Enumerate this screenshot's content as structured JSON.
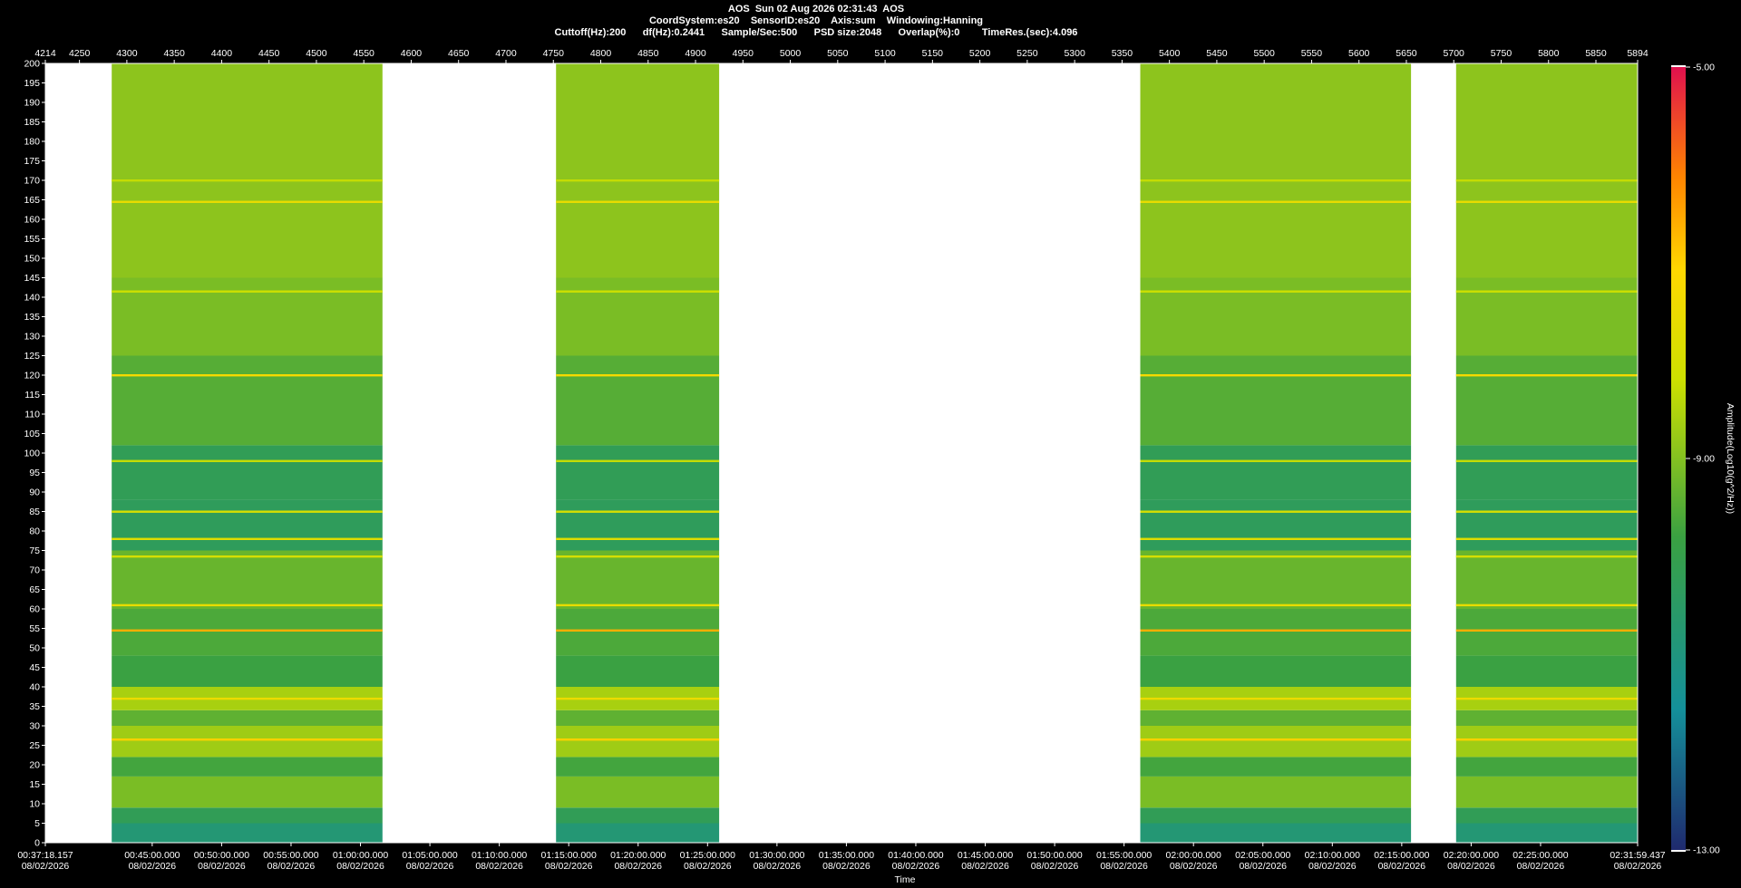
{
  "header": {
    "title": "AOS  Sun 02 Aug 2026 02:31:43  AOS",
    "line2": "CoordSystem:es20    SensorID:es20    Axis:sum    Windowing:Hanning",
    "line3": "Cuttoff(Hz):200      df(Hz):0.2441      Sample/Sec:500      PSD size:2048      Overlap(%):0        TimeRes.(sec):4.096"
  },
  "chart_data": {
    "type": "heatmap",
    "title": "AOS  Sun 02 Aug 2026 02:31:43  AOS",
    "xlabel": "Time",
    "ylabel": "",
    "colorbar_label": "Amplitude(Log10(g^2/Hz))",
    "colorbar_ticks": [
      "-5.00",
      "-9.00",
      "-13.00"
    ],
    "colorbar_range": [
      -13,
      -5
    ],
    "ylim": [
      0,
      200
    ],
    "y_ticks": [
      0,
      5,
      10,
      15,
      20,
      25,
      30,
      35,
      40,
      45,
      50,
      55,
      60,
      65,
      70,
      75,
      80,
      85,
      90,
      95,
      100,
      105,
      110,
      115,
      120,
      125,
      130,
      135,
      140,
      145,
      150,
      155,
      160,
      165,
      170,
      175,
      180,
      185,
      190,
      195,
      200
    ],
    "top_axis_range": [
      4214,
      5894
    ],
    "top_ticks": [
      4214,
      4250,
      4300,
      4350,
      4400,
      4450,
      4500,
      4550,
      4600,
      4650,
      4700,
      4750,
      4800,
      4850,
      4900,
      4950,
      5000,
      5050,
      5100,
      5150,
      5200,
      5250,
      5300,
      5350,
      5400,
      5450,
      5500,
      5550,
      5600,
      5650,
      5700,
      5750,
      5800,
      5850,
      5894
    ],
    "x_start": "00:37:18.157",
    "x_end": "02:31:59.437",
    "time_ticks": [
      {
        "time": "00:37:18.157",
        "date": "08/02/2026"
      },
      {
        "time": "00:45:00.000",
        "date": "08/02/2026"
      },
      {
        "time": "00:50:00.000",
        "date": "08/02/2026"
      },
      {
        "time": "00:55:00.000",
        "date": "08/02/2026"
      },
      {
        "time": "01:00:00.000",
        "date": "08/02/2026"
      },
      {
        "time": "01:05:00.000",
        "date": "08/02/2026"
      },
      {
        "time": "01:10:00.000",
        "date": "08/02/2026"
      },
      {
        "time": "01:15:00.000",
        "date": "08/02/2026"
      },
      {
        "time": "01:20:00.000",
        "date": "08/02/2026"
      },
      {
        "time": "01:25:00.000",
        "date": "08/02/2026"
      },
      {
        "time": "01:30:00.000",
        "date": "08/02/2026"
      },
      {
        "time": "01:35:00.000",
        "date": "08/02/2026"
      },
      {
        "time": "01:40:00.000",
        "date": "08/02/2026"
      },
      {
        "time": "01:45:00.000",
        "date": "08/02/2026"
      },
      {
        "time": "01:50:00.000",
        "date": "08/02/2026"
      },
      {
        "time": "01:55:00.000",
        "date": "08/02/2026"
      },
      {
        "time": "02:00:00.000",
        "date": "08/02/2026"
      },
      {
        "time": "02:05:00.000",
        "date": "08/02/2026"
      },
      {
        "time": "02:10:00.000",
        "date": "08/02/2026"
      },
      {
        "time": "02:15:00.000",
        "date": "08/02/2026"
      },
      {
        "time": "02:20:00.000",
        "date": "08/02/2026"
      },
      {
        "time": "02:25:00.000",
        "date": "08/02/2026"
      },
      {
        "time": "02:31:59.437",
        "date": "08/02/2026"
      }
    ],
    "data_segments": [
      {
        "start": "00:42:05.000",
        "end": "01:01:35.000"
      },
      {
        "start": "01:14:05.000",
        "end": "01:25:50.000"
      },
      {
        "start": "01:56:10.000",
        "end": "02:15:40.000"
      },
      {
        "start": "02:18:55.000",
        "end": "02:31:59.437"
      }
    ],
    "band_profile": [
      {
        "from": 0,
        "to": 5,
        "level": -10.8
      },
      {
        "from": 5,
        "to": 9,
        "level": -10.2
      },
      {
        "from": 9,
        "to": 17,
        "level": -9.1
      },
      {
        "from": 17,
        "to": 22,
        "level": -9.7
      },
      {
        "from": 22,
        "to": 30,
        "level": -8.7
      },
      {
        "from": 30,
        "to": 34,
        "level": -9.4
      },
      {
        "from": 34,
        "to": 40,
        "level": -8.6
      },
      {
        "from": 40,
        "to": 48,
        "level": -9.8
      },
      {
        "from": 48,
        "to": 60,
        "level": -9.6
      },
      {
        "from": 60,
        "to": 75,
        "level": -9.3
      },
      {
        "from": 75,
        "to": 88,
        "level": -10.3
      },
      {
        "from": 88,
        "to": 102,
        "level": -10.2
      },
      {
        "from": 102,
        "to": 125,
        "level": -9.5
      },
      {
        "from": 125,
        "to": 145,
        "level": -9.1
      },
      {
        "from": 145,
        "to": 200,
        "level": -8.9
      }
    ],
    "tonal_lines": [
      {
        "freq": 26.5,
        "level": -7.0
      },
      {
        "freq": 37,
        "level": -7.5
      },
      {
        "freq": 54.5,
        "level": -6.6
      },
      {
        "freq": 61,
        "level": -7.6
      },
      {
        "freq": 73.5,
        "level": -8.0
      },
      {
        "freq": 78,
        "level": -7.8
      },
      {
        "freq": 85,
        "level": -8.0
      },
      {
        "freq": 98,
        "level": -8.3
      },
      {
        "freq": 120,
        "level": -7.3
      },
      {
        "freq": 141.5,
        "level": -8.2
      },
      {
        "freq": 164.5,
        "level": -7.6
      },
      {
        "freq": 170,
        "level": -8.3
      }
    ]
  }
}
